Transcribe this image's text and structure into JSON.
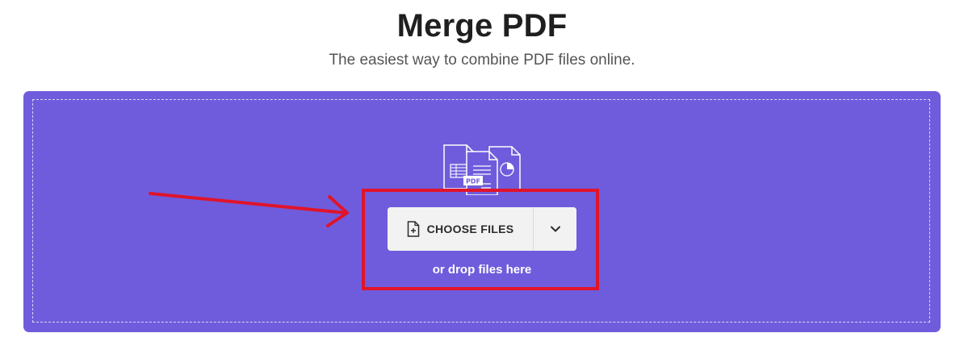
{
  "page": {
    "title": "Merge PDF",
    "subtitle": "The easiest way to combine PDF files online."
  },
  "uploader": {
    "illustration_badge": "PDF",
    "choose_files_label": "CHOOSE FILES",
    "drop_hint": "or drop files here",
    "icons": {
      "illustration": "documents-icon",
      "choose": "file-add-icon",
      "dropdown": "chevron-down-icon"
    }
  },
  "colors": {
    "panel_background": "#6f5cdc",
    "button_background": "#f2f2f2",
    "annotation": "#e0142a",
    "title": "#1f1f1f",
    "subtitle": "#555555"
  }
}
